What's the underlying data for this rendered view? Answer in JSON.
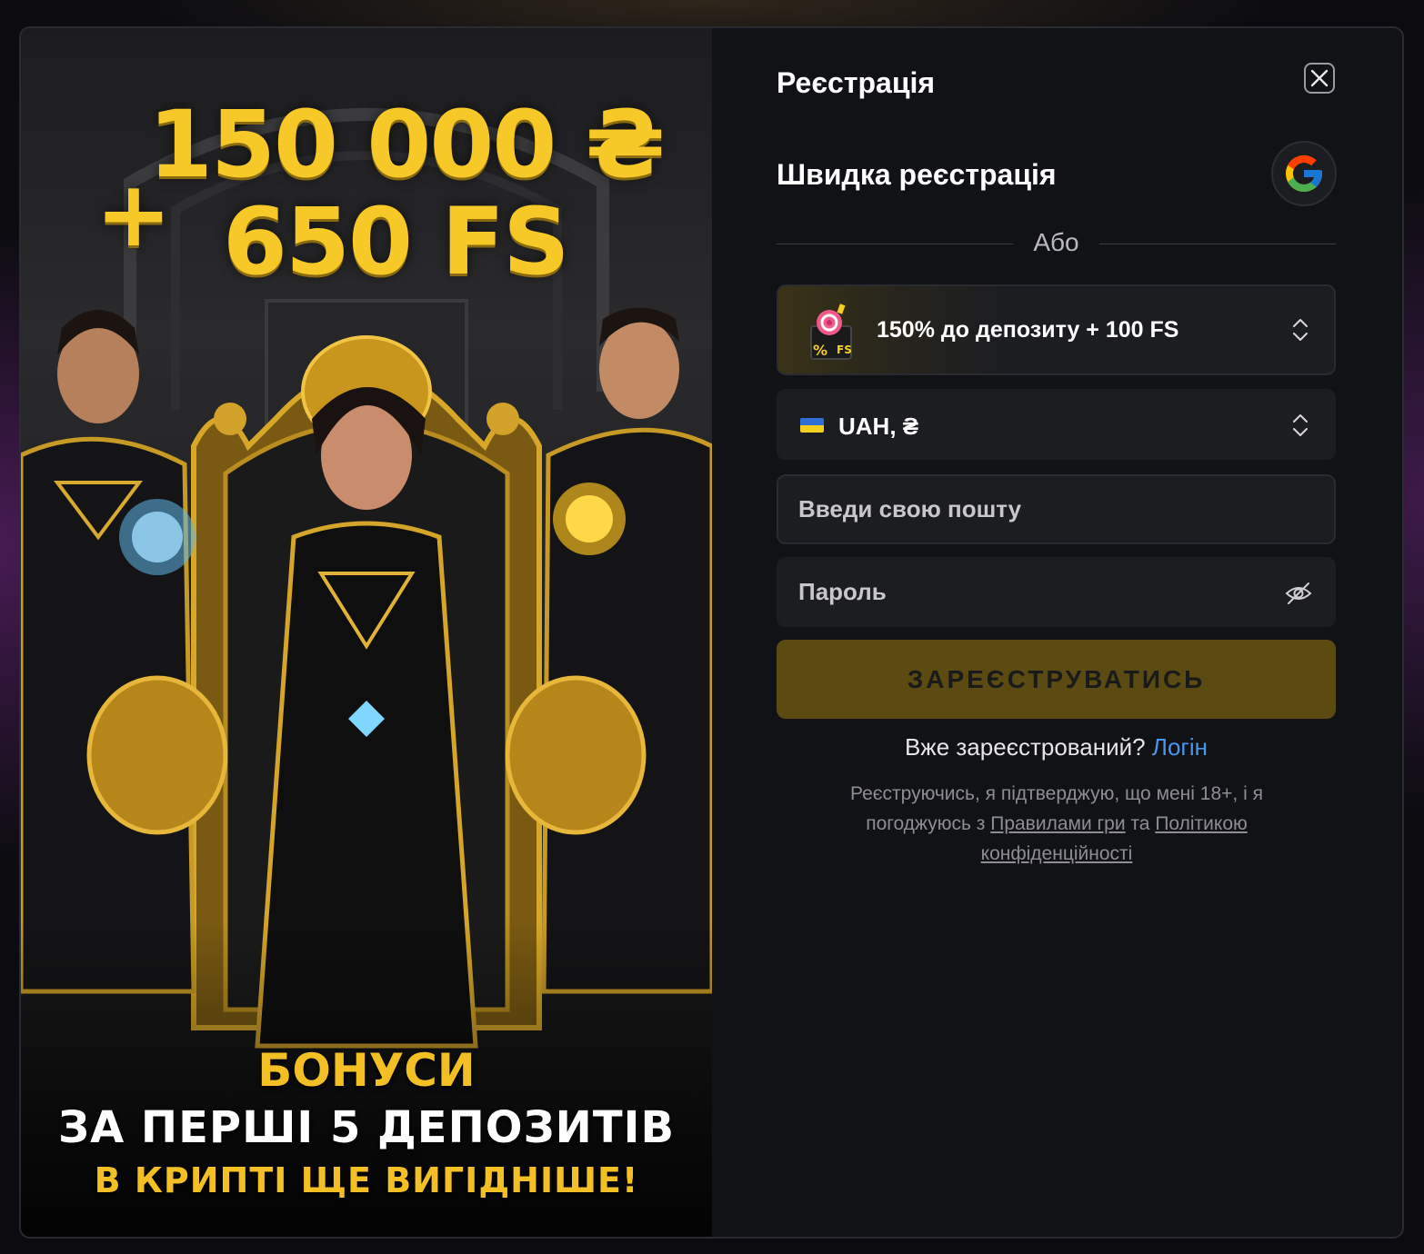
{
  "banner": {
    "promo_plus": "+",
    "promo_amount": "150 000 ₴",
    "promo_fs": "650 FS",
    "bottom_line1": "БОНУСИ",
    "bottom_line2": "ЗА ПЕРШІ 5 ДЕПОЗИТІВ",
    "bottom_line3": "В КРИПТІ ЩЕ ВИГІДНІШЕ!"
  },
  "form": {
    "title": "Реєстрація",
    "quick_title": "Швидка реєстрація",
    "divider_text": "Або",
    "bonus": {
      "label": "150% до депозиту + 100 FS",
      "icon": "bonus-gift-icon"
    },
    "currency": {
      "label": "UAH, ₴",
      "icon": "ukraine-flag-icon"
    },
    "email": {
      "placeholder": "Введи свою пошту",
      "value": ""
    },
    "password": {
      "placeholder": "Пароль",
      "value": ""
    },
    "submit_label": "ЗАРЕЄСТРУВАТИСЬ",
    "login_prompt": "Вже зареєстрований?",
    "login_link": "Логін",
    "terms": {
      "text1": "Реєструючись, я підтверджую, що мені 18+, і я погоджуюсь з",
      "link1": "Правилами гри",
      "text2": "та",
      "link2": "Політикою конфіденційності"
    }
  },
  "colors": {
    "accent_gold": "#f6c928",
    "submit_bg": "#5b4b12",
    "link_blue": "#4a95f0",
    "modal_bg": "#111216"
  }
}
